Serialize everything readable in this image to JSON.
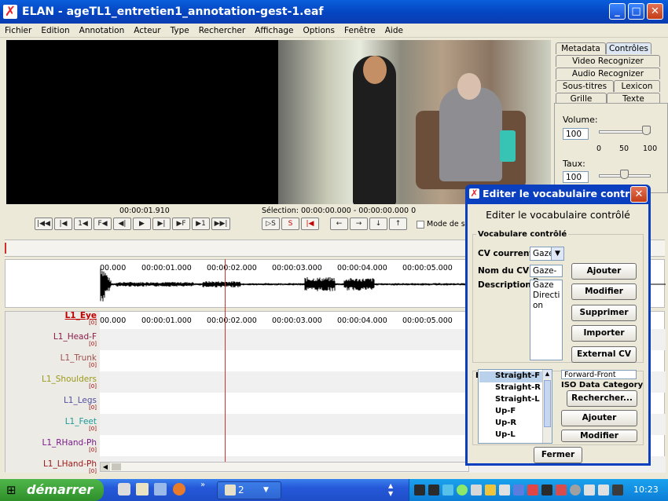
{
  "window": {
    "title": "ELAN - ageTL1_entretien1_annotation-gest-1.eaf",
    "min": "_",
    "max": "□",
    "close": "✕"
  },
  "menu": [
    "Fichier",
    "Edition",
    "Annotation",
    "Acteur",
    "Type",
    "Rechercher",
    "Affichage",
    "Options",
    "Fenêtre",
    "Aide"
  ],
  "tabs": {
    "metadata": "Metadata",
    "controles": "Contrôles",
    "video_recognizer": "Video Recognizer",
    "audio_recognizer": "Audio Recognizer",
    "sous_titres": "Sous-titres",
    "lexicon": "Lexicon",
    "grille": "Grille",
    "texte": "Texte"
  },
  "controls": {
    "volume_label": "Volume:",
    "volume_value": "100",
    "volume_ticks": [
      "0",
      "50",
      "100"
    ],
    "volume_level_pct": 100,
    "taux_label": "Taux:",
    "taux_value": "100"
  },
  "media": {
    "time": "00:00:01.910",
    "selection": "Sélection: 00:00:00.000 - 00:00:00.000  0",
    "selection_mode": "Mode de sé"
  },
  "transport": [
    "|◀◀",
    "|◀",
    "1◀",
    "F◀",
    "◀|",
    "▶",
    "▶|",
    "▶F",
    "▶1",
    "▶▶|"
  ],
  "transport2": [
    "▷S",
    "S",
    "|◀",
    "←",
    "→",
    "↓",
    "↑"
  ],
  "ruler_ticks": [
    "00.000",
    "00:00:01.000",
    "00:00:02.000",
    "00:00:03.000",
    "00:00:04.000",
    "00:00:05.000"
  ],
  "tiers": [
    {
      "name": "L1_Eye",
      "count": "[0]",
      "color": "#c00000"
    },
    {
      "name": "L1_Head-F",
      "count": "[0]",
      "color": "#8b1a4a"
    },
    {
      "name": "L1_Trunk",
      "count": "[0]",
      "color": "#a05050"
    },
    {
      "name": "L1_Shoulders",
      "count": "[0]",
      "color": "#9a9a1a"
    },
    {
      "name": "L1_Legs",
      "count": "[0]",
      "color": "#5050a0"
    },
    {
      "name": "L1_Feet",
      "count": "[0]",
      "color": "#1a9a9a"
    },
    {
      "name": "L1_RHand-Ph",
      "count": "[0]",
      "color": "#7a1a8a"
    },
    {
      "name": "L1_LHand-Ph",
      "count": "[0]",
      "color": "#a01a1a"
    }
  ],
  "dialog": {
    "title": "Editer le vocabulaire contrô",
    "heading": "Editer le vocabulaire contrôlé",
    "group": "Vocabulare contrôlé",
    "cv_current_label": "CV courrent",
    "cv_current_value": "Gaze-",
    "cv_name_label": "Nom du CV",
    "cv_name_value": "Gaze-D",
    "description_label": "Description",
    "description_value": "Gaze Direction",
    "buttons": {
      "add": "Ajouter",
      "modify": "Modifier",
      "delete": "Supprimer",
      "import": "Importer",
      "external": "External CV"
    },
    "entries": [
      "Straight-F",
      "Straight-R",
      "Straight-L",
      "Up-F",
      "Up-R",
      "Up-L"
    ],
    "entry_value": "Forward-Front",
    "iso_label": "ISO Data Category",
    "iso_buttons": {
      "search": "Rechercher...",
      "add": "Ajouter",
      "modify": "Modifier"
    },
    "e_label": "E",
    "close": "Fermer"
  },
  "taskbar": {
    "start": "démarrer",
    "task_count": "2",
    "clock": "10:23",
    "quicklaunch_more": "»"
  },
  "colors": {
    "accent": "#0a3fbf",
    "cursor": "#d03030"
  }
}
